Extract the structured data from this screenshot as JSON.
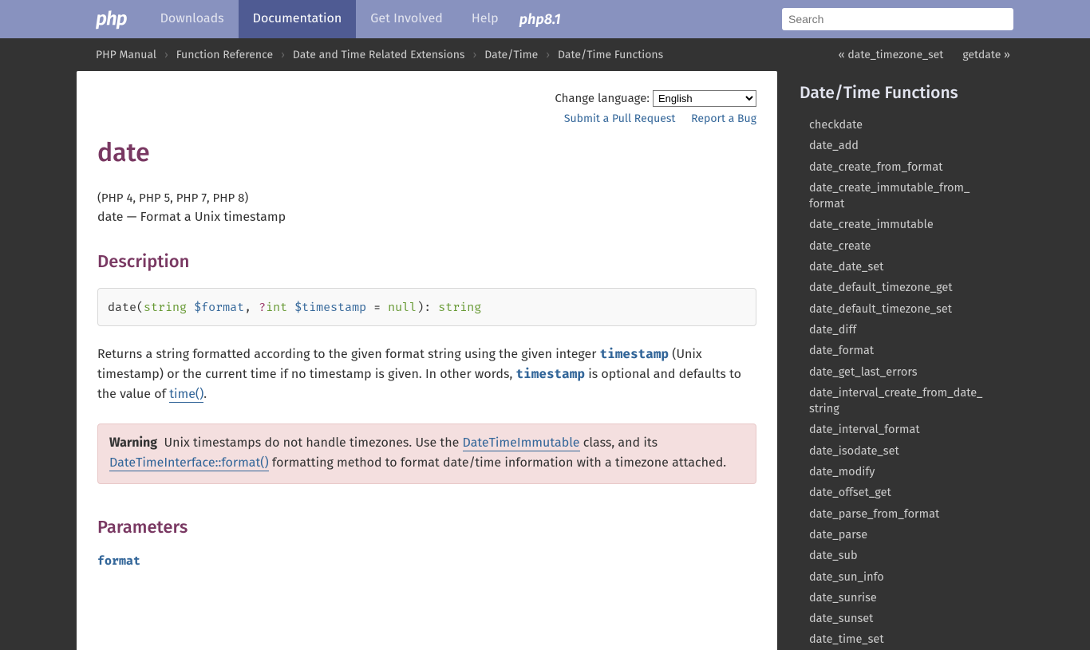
{
  "topbar": {
    "logo": "php",
    "nav": [
      "Downloads",
      "Documentation",
      "Get Involved",
      "Help"
    ],
    "active_index": 1,
    "php81": "php8.1",
    "search_placeholder": "Search"
  },
  "breadcrumbs": [
    "PHP Manual",
    "Function Reference",
    "Date and Time Related Extensions",
    "Date/Time",
    "Date/Time Functions"
  ],
  "pager": {
    "prev": "« date_timezone_set",
    "next": "getdate »"
  },
  "langrow": {
    "label": "Change language:",
    "value": "English"
  },
  "sublinks": {
    "pr": "Submit a Pull Request",
    "bug": "Report a Bug"
  },
  "page": {
    "title": "date",
    "versions": "(PHP 4, PHP 5, PHP 7, PHP 8)",
    "purpose": "date — Format a Unix timestamp",
    "desc_heading": "Description",
    "synopsis": {
      "fn": "date",
      "p1_type": "string",
      "p1_var": "$format",
      "p2_nullable": "?",
      "p2_type": "int",
      "p2_var": "$timestamp",
      "p2_default": "null",
      "ret": "string"
    },
    "desc": {
      "t1": "Returns a string formatted according to the given format string using the given integer ",
      "ts1": "timestamp",
      "t2": " (Unix timestamp) or the current time if no timestamp is given. In other words, ",
      "ts2": "timestamp",
      "t3": " is optional and defaults to the value of ",
      "timefn": "time()",
      "t4": "."
    },
    "warning": {
      "label": "Warning",
      "t1": "Unix timestamps do not handle timezones. Use the ",
      "link1": "DateTimeImmutable",
      "t2": " class, and its ",
      "link2": "DateTimeInterface::format()",
      "t3": " formatting method to format date/time information with a timezone attached."
    },
    "params_heading": "Parameters",
    "param1": "format"
  },
  "sidebar": {
    "title": "Date/Time Functions",
    "items": [
      "checkdate",
      "date_add",
      "date_create_from_format",
      "date_create_immutable_from_format",
      "date_create_immutable",
      "date_create",
      "date_date_set",
      "date_default_timezone_get",
      "date_default_timezone_set",
      "date_diff",
      "date_format",
      "date_get_last_errors",
      "date_interval_create_from_date_string",
      "date_interval_format",
      "date_isodate_set",
      "date_modify",
      "date_offset_get",
      "date_parse_from_format",
      "date_parse",
      "date_sub",
      "date_sun_info",
      "date_sunrise",
      "date_sunset",
      "date_time_set"
    ]
  }
}
